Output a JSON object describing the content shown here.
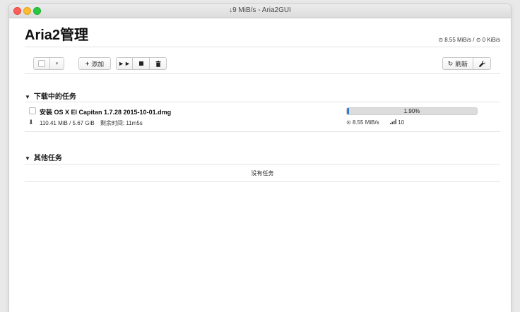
{
  "window": {
    "title": "↓9 MiB/s - Aria2GUI"
  },
  "header": {
    "title": "Aria2管理",
    "global_speed": "8.55 MiB/s / ",
    "global_upload": "0 KiB/s"
  },
  "toolbar": {
    "add_label": "添加",
    "refresh_label": "刷新"
  },
  "sections": {
    "downloading": "下载中的任务",
    "others": "其他任务"
  },
  "tasks": [
    {
      "name": "安装 OS X El Capitan 1.7.28 2015-10-01.dmg",
      "size": "110.41 MiB / 5.67 GiB",
      "remaining": "剩余时间: 11m5s",
      "progress_text": "1.90%",
      "progress_fraction": 0.019,
      "speed": "8.55 MiB/s",
      "connections": "10"
    }
  ],
  "others": {
    "empty_text": "没有任务"
  },
  "colors": {
    "progress_fill": "#2f7bd6",
    "progress_track": "#dcdcdc"
  }
}
